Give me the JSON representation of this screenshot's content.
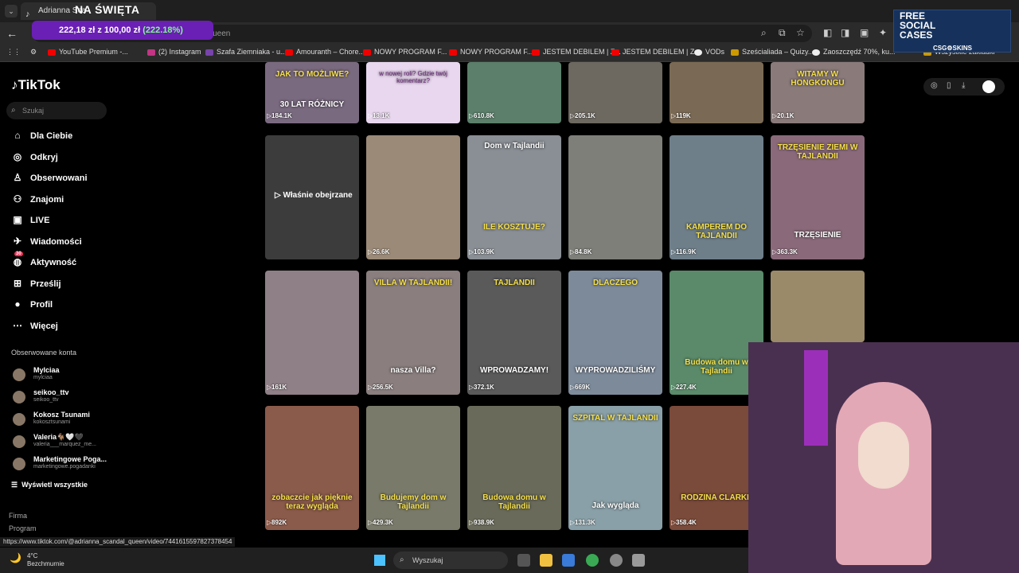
{
  "browser": {
    "tab_title": "Adrianna Sca",
    "stream_overlay_title": "NA ŚWIĘTA",
    "url_fragment": "_queen",
    "donation_goal": {
      "raised": "222,18 zł",
      "of": "z",
      "goal": "100,00 zł",
      "percent": "(222.18%)"
    },
    "bookmarks": [
      {
        "label": "YouTube Premium -...",
        "icon": "youtube-icon"
      },
      {
        "label": "(2) Instagram",
        "icon": "instagram-icon"
      },
      {
        "label": "Szafa Ziemniaka - u...",
        "icon": "twitch-icon"
      },
      {
        "label": "Amouranth – Chore...",
        "icon": "youtube-icon"
      },
      {
        "label": "NOWY PROGRAM F...",
        "icon": "youtube-icon"
      },
      {
        "label": "NOWY PROGRAM F...",
        "icon": "youtube-icon"
      },
      {
        "label": "JESTEM DEBILEM | Z...",
        "icon": "youtube-icon"
      },
      {
        "label": "JESTEM DEBILEM | Z...",
        "icon": "youtube-icon"
      },
      {
        "label": "VODs",
        "icon": "globe-icon"
      },
      {
        "label": "Sześcialiada – Quizy...",
        "icon": "person-icon"
      },
      {
        "label": "Zaoszczędź 70%, ku...",
        "icon": "steam-icon"
      },
      {
        "label": "Wszystkie zakładki",
        "icon": "folder-icon"
      }
    ],
    "ad": {
      "line1": "FREE",
      "line2": "SOCIAL",
      "line3": "CASES",
      "brand": "CSG⚙SKINS"
    },
    "status_url": "https://www.tiktok.com/@adrianna_scandal_queen/video/7441615597827378454"
  },
  "tiktok": {
    "logo": "TikTok",
    "search_placeholder": "Szukaj",
    "menu": [
      {
        "label": "Dla Ciebie",
        "icon": "home-icon"
      },
      {
        "label": "Odkryj",
        "icon": "compass-icon"
      },
      {
        "label": "Obserwowani",
        "icon": "following-icon"
      },
      {
        "label": "Znajomi",
        "icon": "friends-icon"
      },
      {
        "label": "LIVE",
        "icon": "live-icon"
      },
      {
        "label": "Wiadomości",
        "icon": "messages-icon"
      },
      {
        "label": "Aktywność",
        "icon": "activity-icon",
        "badge": "30"
      },
      {
        "label": "Prześlij",
        "icon": "upload-icon"
      },
      {
        "label": "Profil",
        "icon": "profile-icon"
      },
      {
        "label": "Więcej",
        "icon": "more-icon"
      }
    ],
    "followed_title": "Obserwowane konta",
    "followed": [
      {
        "name": "Mylciaa",
        "handle": "mylciaa"
      },
      {
        "name": "seikoo_ttv",
        "handle": "seikoo_ttv"
      },
      {
        "name": "Kokosz Tsunami",
        "handle": "kokosztsunami"
      },
      {
        "name": "Valeria🐐🤍🖤",
        "handle": "valeria___marquez_me..."
      },
      {
        "name": "Marketingowe Poga...",
        "handle": "marketingowe.pogadanki"
      }
    ],
    "view_all": "Wyświetl wszystkie",
    "footer": [
      "Firma",
      "Program"
    ],
    "watched_label": "▷ Właśnie obejrzane",
    "videos": [
      {
        "views": "184.1K",
        "caption": "JAK TO MOŻLIWE?",
        "caption2": "30 LAT RÓŻNICY",
        "color": "#7a6a80"
      },
      {
        "views": "13.1K",
        "caption": "w nowej roli? Gdzie twój komentarz?",
        "color": "#e8d7ee"
      },
      {
        "views": "610.8K",
        "caption": "",
        "color": "#5b7f6a"
      },
      {
        "views": "205.1K",
        "caption": "",
        "color": "#6d6860"
      },
      {
        "views": "119K",
        "caption": "",
        "color": "#7a6a55"
      },
      {
        "views": "20.1K",
        "caption": "WITAMY W HONGKONGU",
        "color": "#8a7a7a"
      },
      {
        "views": "",
        "caption": "",
        "color": "#3c3c3c"
      },
      {
        "views": "26.6K",
        "caption": "",
        "color": "#9b8a78"
      },
      {
        "views": "103.9K",
        "caption": "ILE KOSZTUJE?",
        "caption_top": "Dom w Tajlandii",
        "color": "#8a8f95"
      },
      {
        "views": "84.8K",
        "caption": "",
        "color": "#7d7f78"
      },
      {
        "views": "116.9K",
        "caption": "KAMPEREM DO TAJLANDII",
        "color": "#6f7f8a"
      },
      {
        "views": "363.3K",
        "caption": "TRZĘSIENIE ZIEMI W TAJLANDII",
        "caption2": "TRZĘSIENIE",
        "color": "#8a6a7a"
      },
      {
        "views": "161K",
        "caption": "",
        "color": "#8f7f86"
      },
      {
        "views": "256.5K",
        "caption": "VILLA W TAJLANDII!",
        "caption2": "nasza Villa?",
        "color": "#8a7e7e"
      },
      {
        "views": "372.1K",
        "caption": "TAJLANDII",
        "caption2": "WPROWADZAMY!",
        "color": "#5a5a5a"
      },
      {
        "views": "669K",
        "caption": "DLACZEGO",
        "caption2": "WYPROWADZILIŚMY",
        "color": "#7d8a9a"
      },
      {
        "views": "227.4K",
        "caption": "Budowa domu w Tajlandii",
        "color": "#5a8a6a"
      },
      {
        "views": "",
        "caption": "",
        "color": "#9a8a6a"
      },
      {
        "views": "892K",
        "caption": "zobaczcie jak pięknie teraz wygląda",
        "color": "#8a5a4a"
      },
      {
        "views": "429.3K",
        "caption": "Budujemy dom w Tajlandii",
        "color": "#7a7a6a"
      },
      {
        "views": "938.9K",
        "caption": "Budowa domu w Tajlandii",
        "color": "#6a6a5a"
      },
      {
        "views": "131.3K",
        "caption": "SZPITAL W TAJLANDII",
        "caption2": "Jak wygląda",
        "color": "#8aa0a8"
      },
      {
        "views": "358.4K",
        "caption": "RODZINA CLARKE",
        "color": "#7a4a3a"
      }
    ]
  },
  "taskbar": {
    "temp": "4°C",
    "weather": "Bezchmurnie",
    "search_placeholder": "Wyszukaj"
  }
}
